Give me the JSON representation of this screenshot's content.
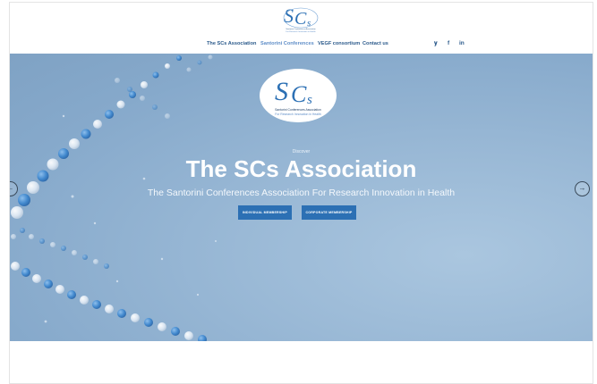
{
  "brand": {
    "mark": "SCs",
    "logo_line1": "Santorini Conferences Association",
    "logo_line2": "For Research Innovation in Health"
  },
  "nav": {
    "items": [
      {
        "label": "The SCs Association"
      },
      {
        "label": "Santorini Conferences"
      },
      {
        "label": "VEGF consortium"
      },
      {
        "label": "Contact us"
      }
    ],
    "active_index": 1,
    "social": [
      {
        "icon": "twitter-icon",
        "glyph": "𝐲"
      },
      {
        "icon": "facebook-icon",
        "glyph": "f"
      },
      {
        "icon": "linkedin-icon",
        "glyph": "in"
      }
    ]
  },
  "hero": {
    "kicker": "Discover",
    "title": "The SCs Association",
    "subtitle": "The Santorini Conferences Association For Research Innovation in Health",
    "buttons": [
      {
        "label": "INDIVIDUAL MEMBERSHIP"
      },
      {
        "label": "CORPORATE MEMBERSHIP"
      }
    ],
    "prev_arrow": "←",
    "next_arrow": "→"
  },
  "colors": {
    "nav_text": "#2b5a8b",
    "nav_active": "#5f8ec8",
    "button_bg": "#2c70b4",
    "hero_bg": "#8fb0d0"
  }
}
